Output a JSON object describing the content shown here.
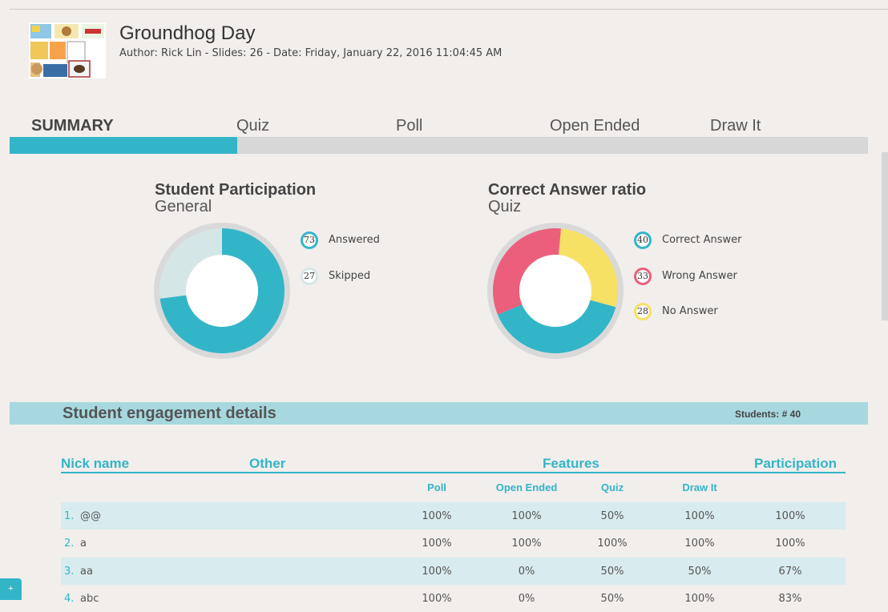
{
  "header": {
    "title": "Groundhog Day",
    "meta": "Author: Rick Lin - Slides: 26 - Date: Friday, January 22, 2016 11:04:45 AM",
    "thumbnail_icon": "lesson-thumbnail-collage"
  },
  "tabs": [
    {
      "label": "SUMMARY",
      "active": true
    },
    {
      "label": "Quiz",
      "active": false
    },
    {
      "label": "Poll",
      "active": false
    },
    {
      "label": "Open Ended",
      "active": false
    },
    {
      "label": "Draw It",
      "active": false
    }
  ],
  "tab_progress_fraction": 0.265,
  "participation": {
    "title": "Student Participation",
    "subtitle": "General",
    "items": [
      {
        "value": "73",
        "label": "Answered",
        "color": "#33b5c8"
      },
      {
        "value": "27",
        "label": "Skipped",
        "color": "#d4e7e6"
      }
    ]
  },
  "correct_ratio": {
    "title": "Correct Answer ratio",
    "subtitle": "Quiz",
    "items": [
      {
        "value": "40",
        "label": "Correct Answer",
        "color": "#33b5c8"
      },
      {
        "value": "33",
        "label": "Wrong Answer",
        "color": "#ec5f7c"
      },
      {
        "value": "28",
        "label": "No Answer",
        "color": "#f7e164"
      }
    ]
  },
  "engagement": {
    "title": "Student engagement details",
    "students": "Students: # 40",
    "headers": {
      "nick": "Nick name",
      "other": "Other",
      "features": "Features",
      "participation": "Participation"
    },
    "feature_columns": [
      "Poll",
      "Open Ended",
      "Quiz",
      "Draw It"
    ],
    "rows": [
      {
        "idx": "1.",
        "nick": "@@",
        "poll": "100%",
        "open": "100%",
        "quiz": "50%",
        "draw": "100%",
        "part": "100%"
      },
      {
        "idx": "2.",
        "nick": "a",
        "poll": "100%",
        "open": "100%",
        "quiz": "100%",
        "draw": "100%",
        "part": "100%"
      },
      {
        "idx": "3.",
        "nick": "aa",
        "poll": "100%",
        "open": "0%",
        "quiz": "50%",
        "draw": "50%",
        "part": "67%"
      },
      {
        "idx": "4.",
        "nick": "abc",
        "poll": "100%",
        "open": "0%",
        "quiz": "50%",
        "draw": "100%",
        "part": "83%"
      }
    ]
  },
  "chat_tab": "+"
}
